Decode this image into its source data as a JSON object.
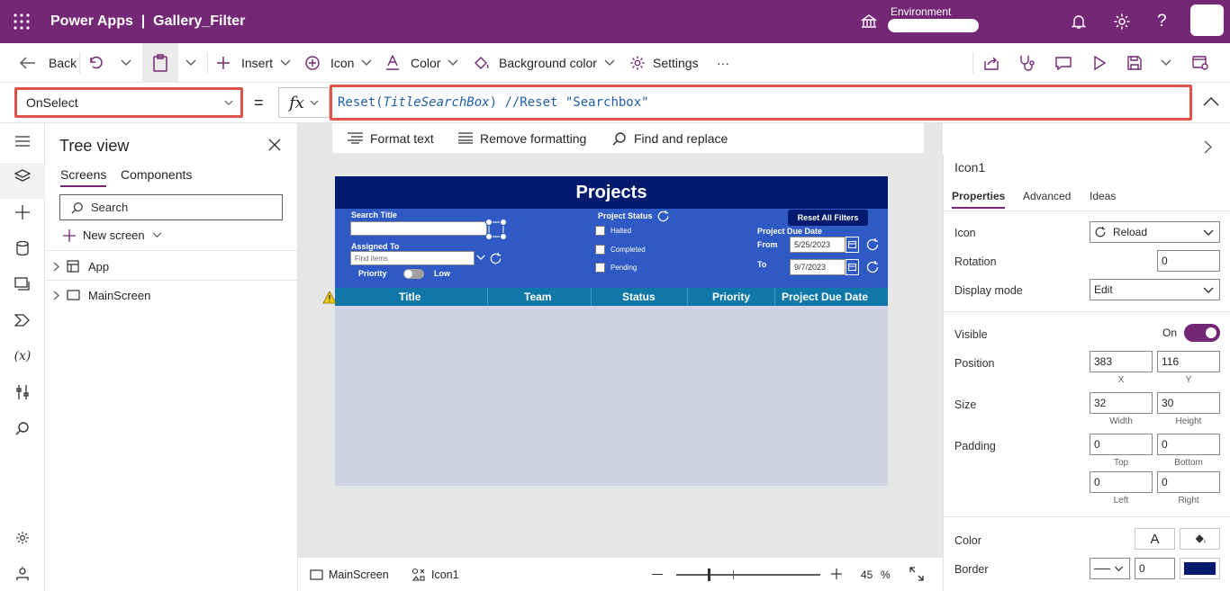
{
  "app_header": {
    "title": "Power Apps  |  Gallery_Filter",
    "environment_label": "Environment"
  },
  "toolbar": {
    "back": "Back",
    "insert": "Insert",
    "icon": "Icon",
    "color": "Color",
    "background_color": "Background color",
    "settings": "Settings",
    "more": "···"
  },
  "formula_bar": {
    "property": "OnSelect",
    "equals": "=",
    "fx": "fx",
    "fn": "Reset(",
    "arg": "TitleSearchBox",
    "rest": ") //Reset \"Searchbox\""
  },
  "format_bar": {
    "format_text": "Format text",
    "remove_formatting": "Remove formatting",
    "find_replace": "Find and replace"
  },
  "tree": {
    "title": "Tree view",
    "tabs": [
      "Screens",
      "Components"
    ],
    "search_placeholder": "Search",
    "new_screen": "New screen",
    "items": [
      "App",
      "MainScreen"
    ]
  },
  "canvas_app": {
    "title": "Projects",
    "search_title_label": "Search Title",
    "assigned_to_label": "Assigned To",
    "assigned_placeholder": "Find items",
    "priority_label": "Priority",
    "low_label": "Low",
    "project_status_label": "Project Status",
    "statuses": [
      "Halted",
      "Completed",
      "Pending"
    ],
    "reset_all": "Reset All Filters",
    "due_date_label": "Project Due Date",
    "from_label": "From",
    "to_label": "To",
    "from_date": "5/25/2023",
    "to_date": "9/7/2023",
    "columns": [
      "Title",
      "Team",
      "Status",
      "Priority",
      "Project Due Date"
    ]
  },
  "status_bar": {
    "screen": "MainScreen",
    "control": "Icon1",
    "zoom": "45",
    "zoom_unit": "%"
  },
  "properties_panel": {
    "control_name": "Icon1",
    "tabs": [
      "Properties",
      "Advanced",
      "Ideas"
    ],
    "icon_label": "Icon",
    "icon_value": "Reload",
    "rotation_label": "Rotation",
    "rotation_value": "0",
    "display_mode_label": "Display mode",
    "display_mode_value": "Edit",
    "visible_label": "Visible",
    "visible_value": "On",
    "position_label": "Position",
    "x": "383",
    "y": "116",
    "x_label": "X",
    "y_label": "Y",
    "size_label": "Size",
    "width": "32",
    "height": "30",
    "width_label": "Width",
    "height_label": "Height",
    "padding_label": "Padding",
    "pad_top": "0",
    "pad_bottom": "0",
    "pad_left": "0",
    "pad_right": "0",
    "top_label": "Top",
    "bottom_label": "Bottom",
    "left_label": "Left",
    "right_label": "Right",
    "color_label": "Color",
    "color_glyph": "A",
    "border_label": "Border",
    "border_width": "0",
    "border_color": "#031b6e"
  }
}
